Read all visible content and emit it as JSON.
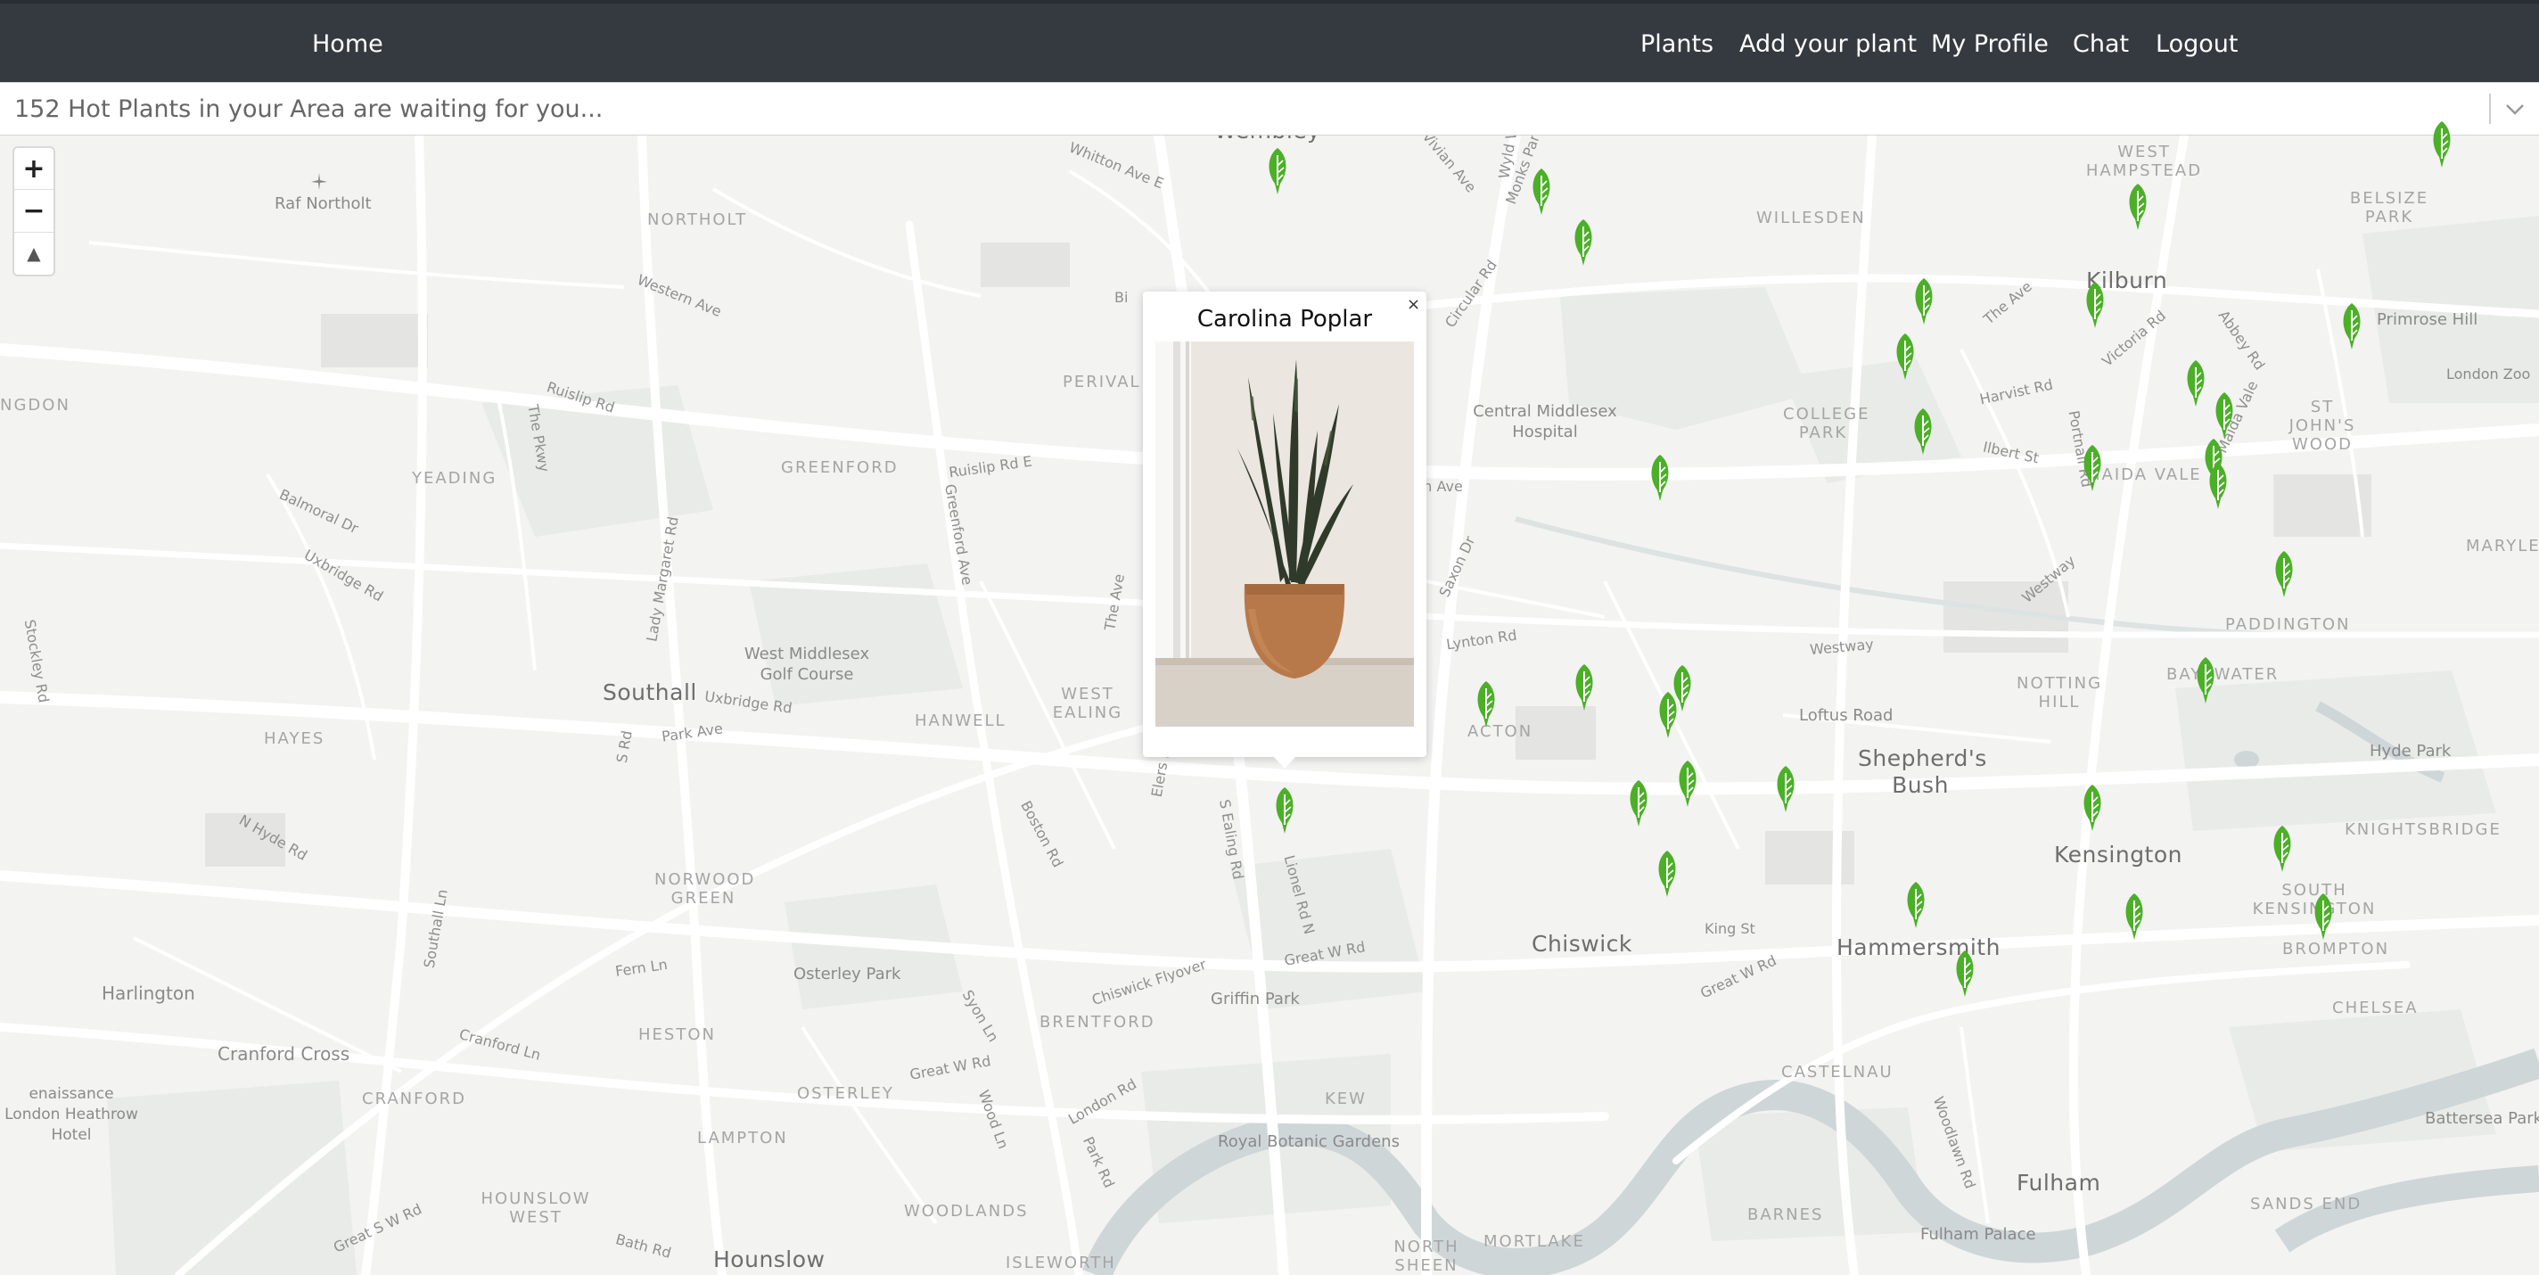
{
  "navbar": {
    "home_label": "Home",
    "links": [
      "Plants",
      "Add your plant",
      "My Profile",
      "Chat",
      "Logout"
    ]
  },
  "search": {
    "placeholder": "152 Hot Plants in your Area are waiting for you..."
  },
  "map": {
    "zoom_in": "+",
    "zoom_out": "−",
    "north": "▲",
    "area_labels": [
      "NORTHOLT",
      "WILLESDEN",
      "WEST HAMPSTEAD",
      "BELSIZE PARK",
      "NGDON",
      "YEADING",
      "GREENFORD",
      "PERIVAL",
      "COLLEGE PARK",
      "ST JOHN'S WOOD",
      "MAIDA VALE",
      "MARYLEB",
      "PADDINGTON",
      "BAYSWATER",
      "NOTTING HILL",
      "HAYES",
      "HANWELL",
      "WEST EALING",
      "ACTON",
      "NORWOOD GREEN",
      "KNIGHTSBRIDGE",
      "SOUTH KENSINGTON",
      "BROMPTON",
      "HESTON",
      "BRENTFORD",
      "CRANFORD",
      "OSTERLEY",
      "LAMPTON",
      "CASTELNAU",
      "CHELSEA",
      "KEW",
      "HOUNSLOW WEST",
      "WOODLANDS",
      "NORTH SHEEN",
      "MORTLAKE",
      "BARNES",
      "SANDS END",
      "ISLEWORTH"
    ],
    "town_labels": [
      "Wembley",
      "Kilburn",
      "Southall",
      "Shepherd's Bush",
      "Kensington",
      "Chiswick",
      "Hammersmith",
      "Fulham",
      "Hounslow"
    ],
    "road_labels": [
      "Whitton Ave E",
      "Vivian Ave",
      "Monks Park",
      "Wyld Way",
      "Western Ave",
      "Circular Rd",
      "The Ave",
      "Victoria Rd",
      "Abbey Rd",
      "Ruislip Rd",
      "Ruislip Rd E",
      "The Pkwy",
      "Harvist Rd",
      "Ilbert St",
      "Portnall Rd",
      "Maida Vale",
      "Balmoral Dr",
      "Uxbridge Rd",
      "Lady Margaret Rd",
      "Greenford Ave",
      "The Ave",
      "Saxon Dr",
      "Westway",
      "Lynton Rd",
      "Westway",
      "Uxbridge Rd",
      "Park Ave",
      "S Rd",
      "Stockley Rd",
      "N Hyde Rd",
      "Boston Rd",
      "Elers Rd",
      "S Ealing Rd",
      "Lionel Rd N",
      "Great W Rd",
      "Chiswick Flyover",
      "King St",
      "Great W Rd",
      "Fern Ln",
      "Southall Ln",
      "Syon Ln",
      "Cranford Ln",
      "Great W Rd",
      "London Rd",
      "Wood Ln",
      "Park Rd",
      "Great S W Rd",
      "Bath Rd",
      "Woodlawn Rd",
      "Bi",
      "rn Ave"
    ],
    "poi_labels": [
      "Raf Northolt",
      "Central Middlesex Hospital",
      "West Middlesex Golf Course",
      "Loftus Road",
      "Primrose Hill",
      "London Zoo",
      "Hyde Park",
      "Osterley Park",
      "Griffin Park",
      "Harlington",
      "Cranford Cross",
      "enaissance London Heathrow Hotel",
      "Royal Botanic Gardens",
      "Fulham Palace",
      "Battersea Park"
    ]
  },
  "popup": {
    "title": "Carolina Poplar",
    "close": "×"
  },
  "colors": {
    "navbar": "#343a40",
    "marker": "#4caf28",
    "map_bg": "#f3f3f2",
    "water": "#cfd6d8",
    "road": "#ffffff"
  },
  "icons": {
    "marker": "leaf-marker-icon",
    "chevron": "chevron-down-icon",
    "close": "close-icon"
  }
}
